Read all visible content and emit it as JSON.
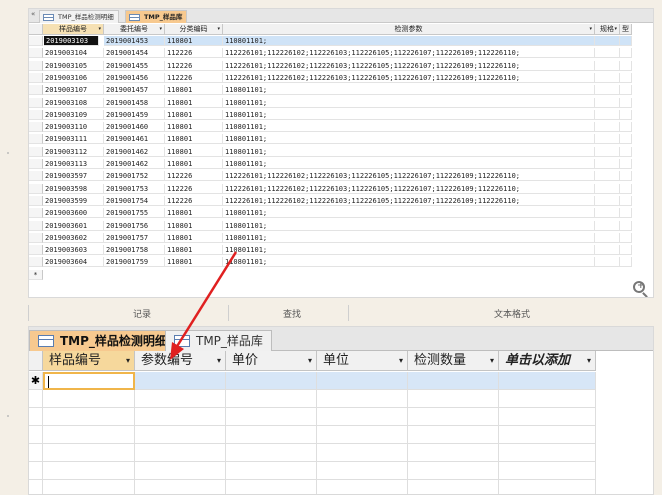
{
  "top_window": {
    "collapse_glyph": "«",
    "tabs": [
      {
        "label": "TMP_样品检测明细",
        "active": false
      },
      {
        "label": "TMP_样品库",
        "active": true
      }
    ],
    "columns": [
      {
        "label": "样品编号",
        "dropdown": "▾"
      },
      {
        "label": "委托编号",
        "dropdown": "▾"
      },
      {
        "label": "分类编码",
        "dropdown": "▾"
      },
      {
        "label": "检测参数",
        "dropdown": "▾"
      },
      {
        "label": "规格",
        "dropdown": "▾"
      },
      {
        "label": "型",
        "dropdown": ""
      }
    ],
    "row_marker_header": "⌕",
    "new_row_marker": "*",
    "rows": [
      [
        "2019003103",
        "2019001453",
        "110801",
        "110801101;"
      ],
      [
        "2019003104",
        "2019001454",
        "112226",
        "112226101;112226102;112226103;112226105;112226107;112226109;112226110;"
      ],
      [
        "2019003105",
        "2019001455",
        "112226",
        "112226101;112226102;112226103;112226105;112226107;112226109;112226110;"
      ],
      [
        "2019003106",
        "2019001456",
        "112226",
        "112226101;112226102;112226103;112226105;112226107;112226109;112226110;"
      ],
      [
        "2019003107",
        "2019001457",
        "110801",
        "110801101;"
      ],
      [
        "2019003108",
        "2019001458",
        "110801",
        "110801101;"
      ],
      [
        "2019003109",
        "2019001459",
        "110801",
        "110801101;"
      ],
      [
        "2019003110",
        "2019001460",
        "110801",
        "110801101;"
      ],
      [
        "2019003111",
        "2019001461",
        "110801",
        "110801101;"
      ],
      [
        "2019003112",
        "2019001462",
        "110801",
        "110801101;"
      ],
      [
        "2019003113",
        "2019001462",
        "110801",
        "110801101;"
      ],
      [
        "2019003597",
        "2019001752",
        "112226",
        "112226101;112226102;112226103;112226105;112226107;112226109;112226110;"
      ],
      [
        "2019003598",
        "2019001753",
        "112226",
        "112226101;112226102;112226103;112226105;112226107;112226109;112226110;"
      ],
      [
        "2019003599",
        "2019001754",
        "112226",
        "112226101;112226102;112226103;112226105;112226107;112226109;112226110;"
      ],
      [
        "2019003600",
        "2019001755",
        "110801",
        "110801101;"
      ],
      [
        "2019003601",
        "2019001756",
        "110801",
        "110801101;"
      ],
      [
        "2019003602",
        "2019001757",
        "110801",
        "110801101;"
      ],
      [
        "2019003603",
        "2019001758",
        "110801",
        "110801101;"
      ],
      [
        "2019003604",
        "2019001759",
        "110801",
        "110801101;"
      ]
    ]
  },
  "status_bar": {
    "records": "记录",
    "find": "查找",
    "text_format": "文本格式"
  },
  "bottom_window": {
    "tabs": [
      {
        "label": "TMP_样品检测明细",
        "active": true
      },
      {
        "label": "TMP_样品库",
        "active": false
      }
    ],
    "columns": [
      {
        "label": "样品编号",
        "dropdown": "▾"
      },
      {
        "label": "参数编号",
        "dropdown": "▾"
      },
      {
        "label": "单价",
        "dropdown": "▾"
      },
      {
        "label": "单位",
        "dropdown": "▾"
      },
      {
        "label": "检测数量",
        "dropdown": "▾"
      },
      {
        "label": "单击以添加",
        "dropdown": "▾"
      }
    ],
    "new_row_marker": "✱"
  },
  "colors": {
    "active_tab": "#f7c98f",
    "selected_row": "#cfe3f7",
    "new_row": "#d7e6f7",
    "arrow": "#e02020"
  },
  "icons": [
    "table-icon",
    "zoom-in-icon",
    "dropdown-arrow-icon"
  ]
}
